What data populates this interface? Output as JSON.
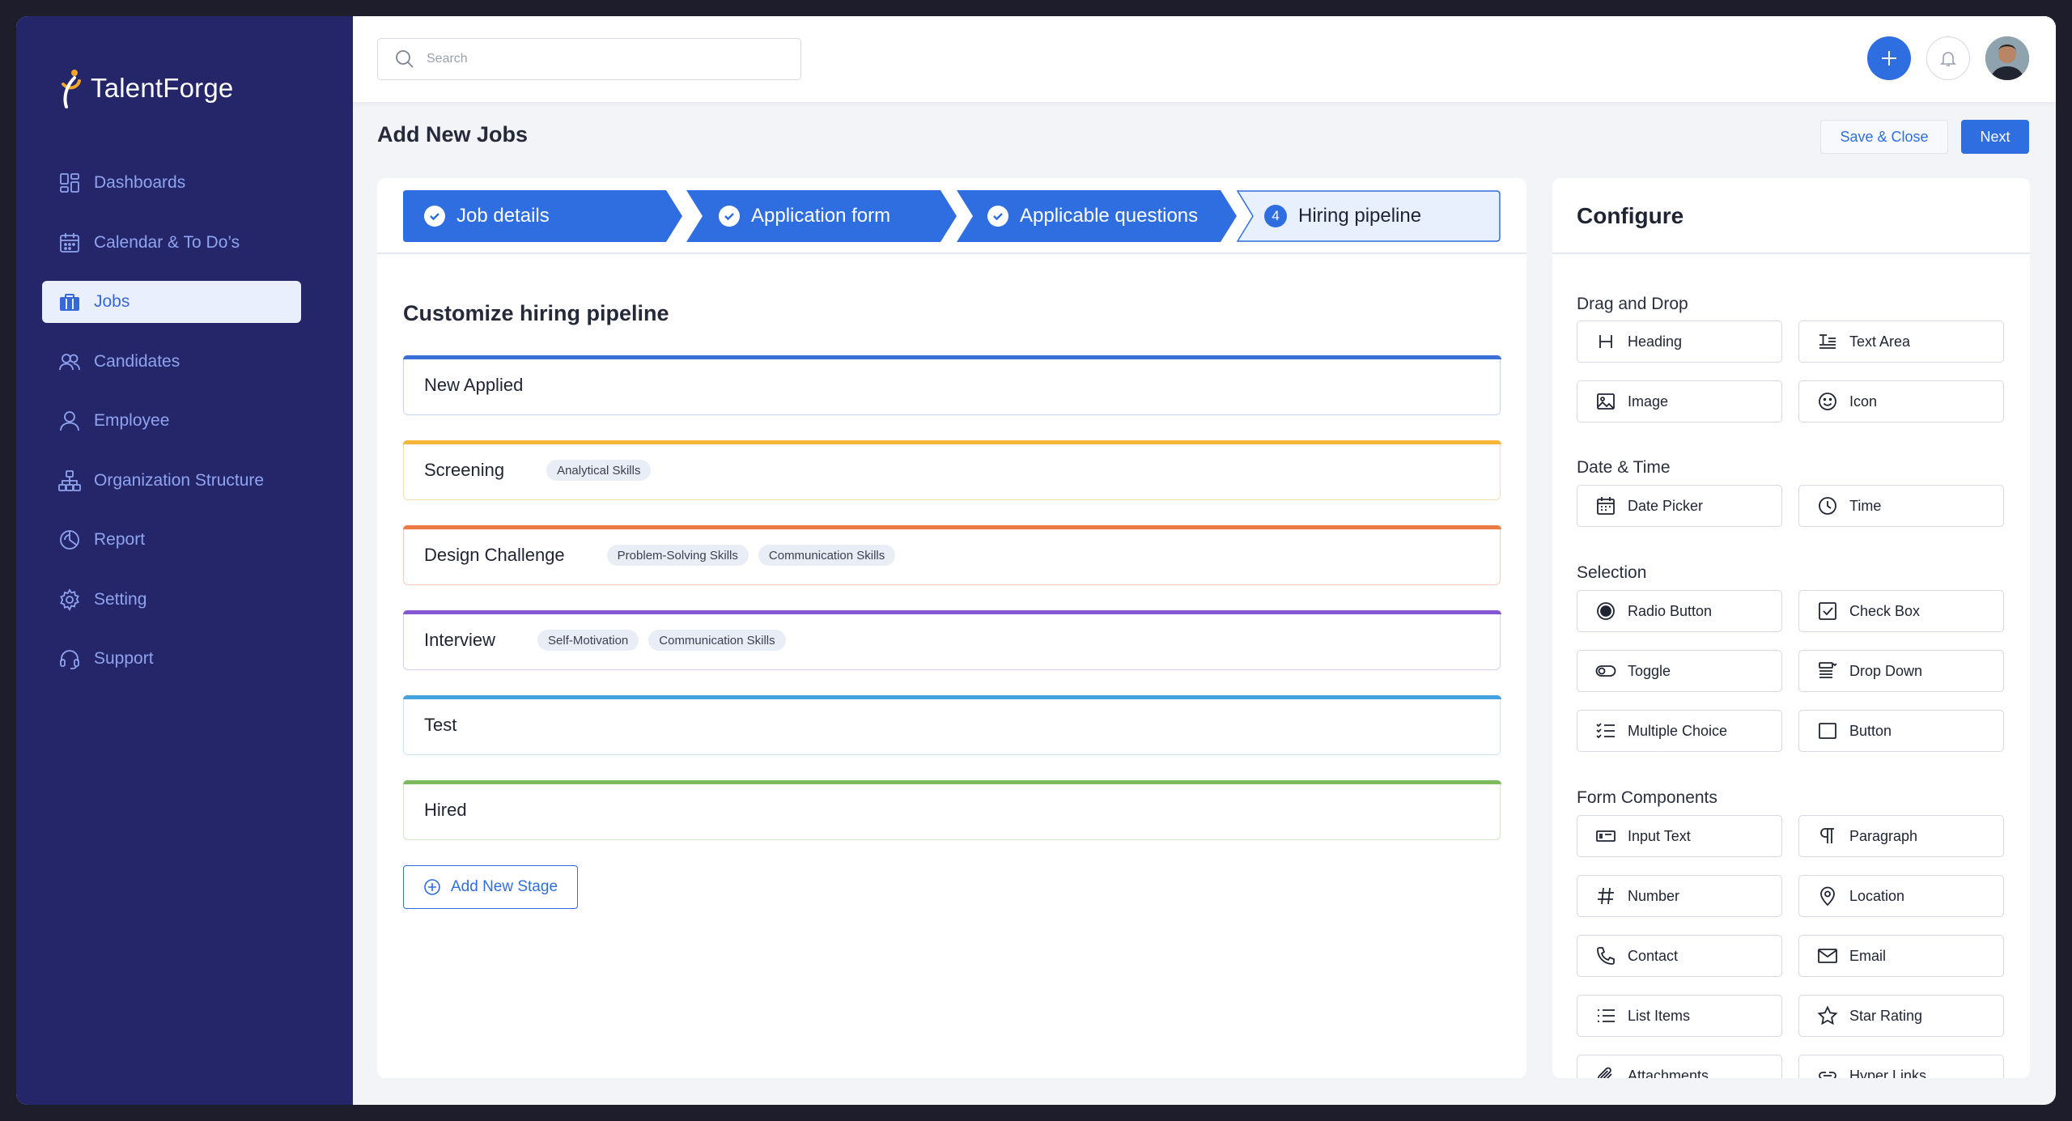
{
  "app": {
    "name": "TalentForge"
  },
  "sidebar": {
    "items": [
      {
        "label": "Dashboards",
        "icon": "dashboard-icon"
      },
      {
        "label": "Calendar & To Do’s",
        "icon": "calendar-icon"
      },
      {
        "label": "Jobs",
        "icon": "briefcase-icon",
        "active": true
      },
      {
        "label": "Candidates",
        "icon": "users-icon"
      },
      {
        "label": "Employee",
        "icon": "user-icon"
      },
      {
        "label": "Organization Structure",
        "icon": "org-chart-icon"
      },
      {
        "label": "Report",
        "icon": "report-icon"
      },
      {
        "label": "Setting",
        "icon": "gear-icon"
      },
      {
        "label": "Support",
        "icon": "headset-icon"
      }
    ]
  },
  "topbar": {
    "search_placeholder": "Search"
  },
  "page": {
    "title": "Add New Jobs",
    "save_close_label": "Save & Close",
    "next_label": "Next"
  },
  "stepper": {
    "steps": [
      {
        "label": "Job details",
        "status": "done"
      },
      {
        "label": "Application form",
        "status": "done"
      },
      {
        "label": "Applicable questions",
        "status": "done"
      },
      {
        "label": "Hiring pipeline",
        "status": "current",
        "number": "4"
      }
    ]
  },
  "pipeline": {
    "title": "Customize hiring pipeline",
    "stages": [
      {
        "name": "New Applied",
        "color": "#3a6fd8",
        "tags": []
      },
      {
        "name": "Screening",
        "color": "#f5b63a",
        "tags": [
          "Analytical Skills"
        ]
      },
      {
        "name": "Design Challenge",
        "color": "#ec7a45",
        "tags": [
          "Problem-Solving Skills",
          "Communication Skills"
        ]
      },
      {
        "name": "Interview",
        "color": "#8358d2",
        "tags": [
          "Self-Motivation",
          "Communication Skills"
        ]
      },
      {
        "name": "Test",
        "color": "#44a3dc",
        "tags": []
      },
      {
        "name": "Hired",
        "color": "#7bbb5d",
        "tags": []
      }
    ],
    "add_stage_label": "Add New Stage"
  },
  "configure": {
    "title": "Configure",
    "groups": [
      {
        "title": "Drag and Drop",
        "items": [
          {
            "label": "Heading",
            "icon": "heading-icon"
          },
          {
            "label": "Text Area",
            "icon": "text-area-icon"
          },
          {
            "label": "Image",
            "icon": "image-icon"
          },
          {
            "label": "Icon",
            "icon": "smiley-icon"
          }
        ]
      },
      {
        "title": "Date & Time",
        "items": [
          {
            "label": "Date Picker",
            "icon": "calendar-icon"
          },
          {
            "label": "Time",
            "icon": "clock-icon"
          }
        ]
      },
      {
        "title": "Selection",
        "items": [
          {
            "label": "Radio Button",
            "icon": "radio-icon"
          },
          {
            "label": "Check Box",
            "icon": "checkbox-icon"
          },
          {
            "label": "Toggle",
            "icon": "toggle-icon"
          },
          {
            "label": "Drop Down",
            "icon": "dropdown-icon"
          },
          {
            "label": "Multiple Choice",
            "icon": "multiple-choice-icon"
          },
          {
            "label": "Button",
            "icon": "button-icon"
          }
        ]
      },
      {
        "title": "Form Components",
        "items": [
          {
            "label": "Input Text",
            "icon": "input-text-icon"
          },
          {
            "label": "Paragraph",
            "icon": "paragraph-icon"
          },
          {
            "label": "Number",
            "icon": "hash-icon"
          },
          {
            "label": "Location",
            "icon": "location-pin-icon"
          },
          {
            "label": "Contact",
            "icon": "phone-icon"
          },
          {
            "label": "Email",
            "icon": "envelope-icon"
          },
          {
            "label": "List Items",
            "icon": "list-icon"
          },
          {
            "label": "Star Rating",
            "icon": "star-icon"
          },
          {
            "label": "Attachments",
            "icon": "paperclip-icon"
          },
          {
            "label": "Hyper Links",
            "icon": "link-icon"
          }
        ]
      }
    ]
  }
}
